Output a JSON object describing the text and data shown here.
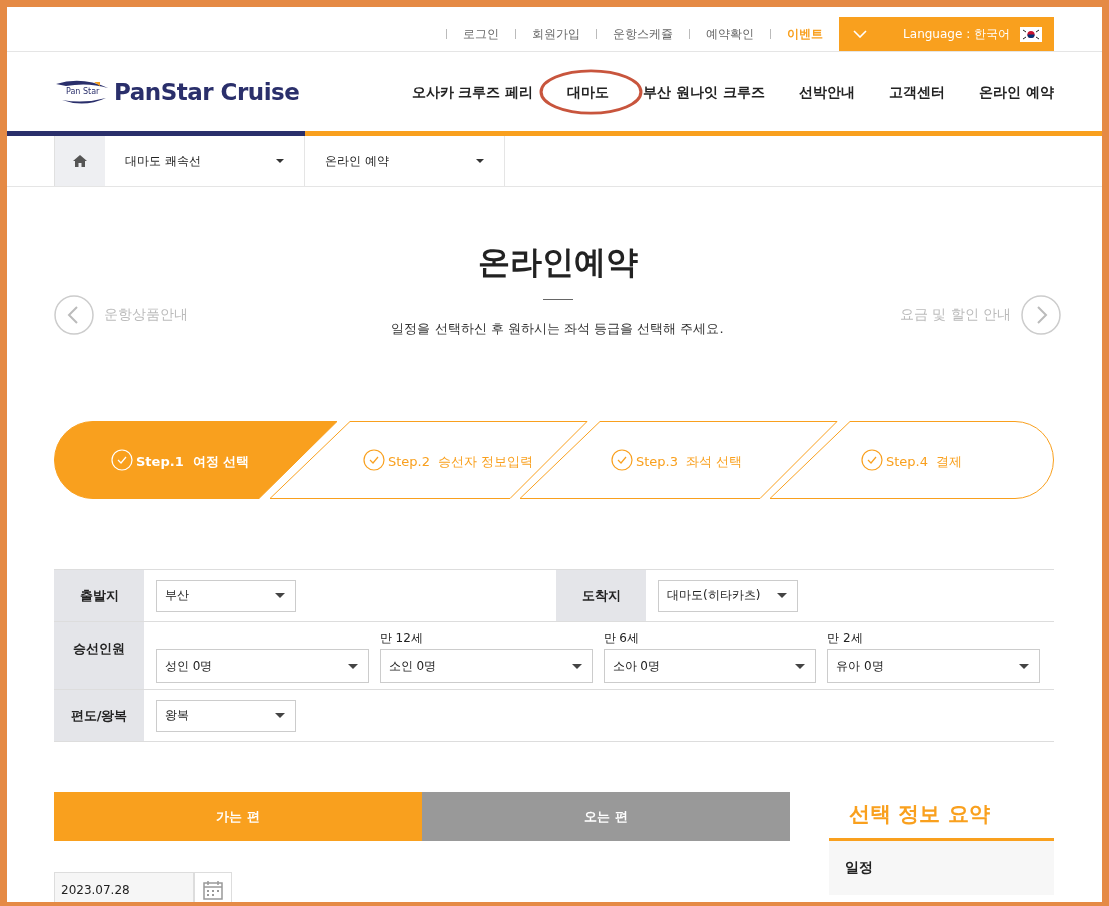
{
  "top_links": [
    {
      "label": "로그인",
      "highlight": false
    },
    {
      "label": "회원가입",
      "highlight": false
    },
    {
      "label": "운항스케쥴",
      "highlight": false
    },
    {
      "label": "예약확인",
      "highlight": false
    },
    {
      "label": "이벤트",
      "highlight": true
    }
  ],
  "language": {
    "label": "Language : 한국어"
  },
  "logo": {
    "small": "Pan Star",
    "name": "PanStar Cruise"
  },
  "nav": [
    {
      "label": "오사카 크루즈 페리",
      "circled": false
    },
    {
      "label": "대마도",
      "circled": true
    },
    {
      "label": "부산 원나잇 크루즈",
      "circled": false
    },
    {
      "label": "선박안내",
      "circled": false
    },
    {
      "label": "고객센터",
      "circled": false
    },
    {
      "label": "온라인 예약",
      "circled": false
    }
  ],
  "breadcrumb": [
    "대마도 쾌속선",
    "온라인 예약"
  ],
  "page": {
    "title": "온라인예약",
    "prev": "운항상품안내",
    "next": "요금 및 할인 안내",
    "subtitle": "일정을 선택하신 후 원하시는 좌석 등급을 선택해 주세요."
  },
  "steps": [
    {
      "step": "Step.1",
      "label": "여정 선택",
      "selected": true
    },
    {
      "step": "Step.2",
      "label": "승선자 정보입력",
      "selected": false
    },
    {
      "step": "Step.3",
      "label": "좌석 선택",
      "selected": false
    },
    {
      "step": "Step.4",
      "label": "결제",
      "selected": false
    }
  ],
  "form": {
    "departure": {
      "label": "출발지",
      "value": "부산"
    },
    "arrival": {
      "label": "도착지",
      "value": "대마도(히타카츠)"
    },
    "passengers": {
      "label": "승선인원",
      "groups": [
        {
          "value": "성인 0명"
        },
        {
          "caption": "만 12세",
          "value": "소인 0명"
        },
        {
          "caption": "만 6세",
          "value": "소아 0명"
        },
        {
          "caption": "만 2세",
          "value": "유아 0명"
        }
      ]
    },
    "trip": {
      "label": "편도/왕복",
      "value": "왕복"
    }
  },
  "direction_tabs": [
    {
      "label": "가는 편",
      "selected": true
    },
    {
      "label": "오는 편",
      "selected": false
    }
  ],
  "date": {
    "value": "2023.07.28"
  },
  "summary": {
    "title": "선택 정보 요약",
    "row": "일정"
  }
}
